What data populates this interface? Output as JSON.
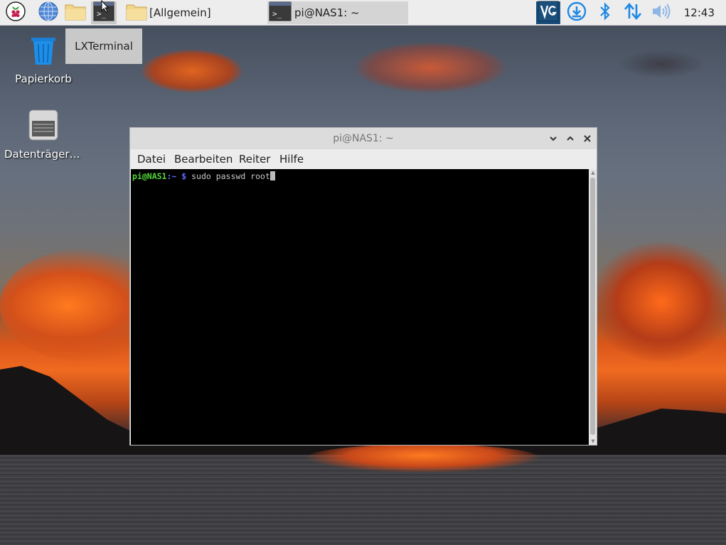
{
  "taskbar": {
    "launchers": [
      {
        "name": "raspberry-menu",
        "icon": "raspberry-icon"
      },
      {
        "name": "web-browser",
        "icon": "globe-icon"
      },
      {
        "name": "file-manager",
        "icon": "folder-icon"
      },
      {
        "name": "terminal",
        "icon": "terminal-icon"
      }
    ],
    "tasks": [
      {
        "label": "[Allgemein]",
        "icon": "folder-icon"
      },
      {
        "label": "pi@NAS1: ~",
        "icon": "terminal-icon"
      }
    ],
    "tray": [
      {
        "name": "vnc",
        "icon": "vnc-icon"
      },
      {
        "name": "updater",
        "icon": "download-icon"
      },
      {
        "name": "bluetooth",
        "icon": "bluetooth-icon"
      },
      {
        "name": "network",
        "icon": "network-arrows-icon"
      },
      {
        "name": "volume",
        "icon": "speaker-icon"
      }
    ],
    "clock": "12:43"
  },
  "tooltip": {
    "text": "LXTerminal"
  },
  "desktop_icons": [
    {
      "label": "Papierkorb",
      "icon": "trash-icon"
    },
    {
      "label": "Datenträger ...",
      "icon": "drive-icon"
    }
  ],
  "window": {
    "title": "pi@NAS1: ~",
    "controls": [
      "minimize",
      "maximize",
      "close"
    ],
    "menu": [
      "Datei",
      "Bearbeiten",
      "Reiter",
      "Hilfe"
    ],
    "terminal": {
      "prompt_user": "pi@NAS1",
      "prompt_path": ":~ $",
      "command": " sudo passwd root"
    }
  },
  "colors": {
    "taskbar_bg": "#ededed",
    "terminal_bg": "#000000",
    "prompt_user": "#54d83c",
    "prompt_path": "#5f6cff",
    "tray_icon_blue": "#1e88e5",
    "vnc_bg": "#1b4f7c"
  }
}
